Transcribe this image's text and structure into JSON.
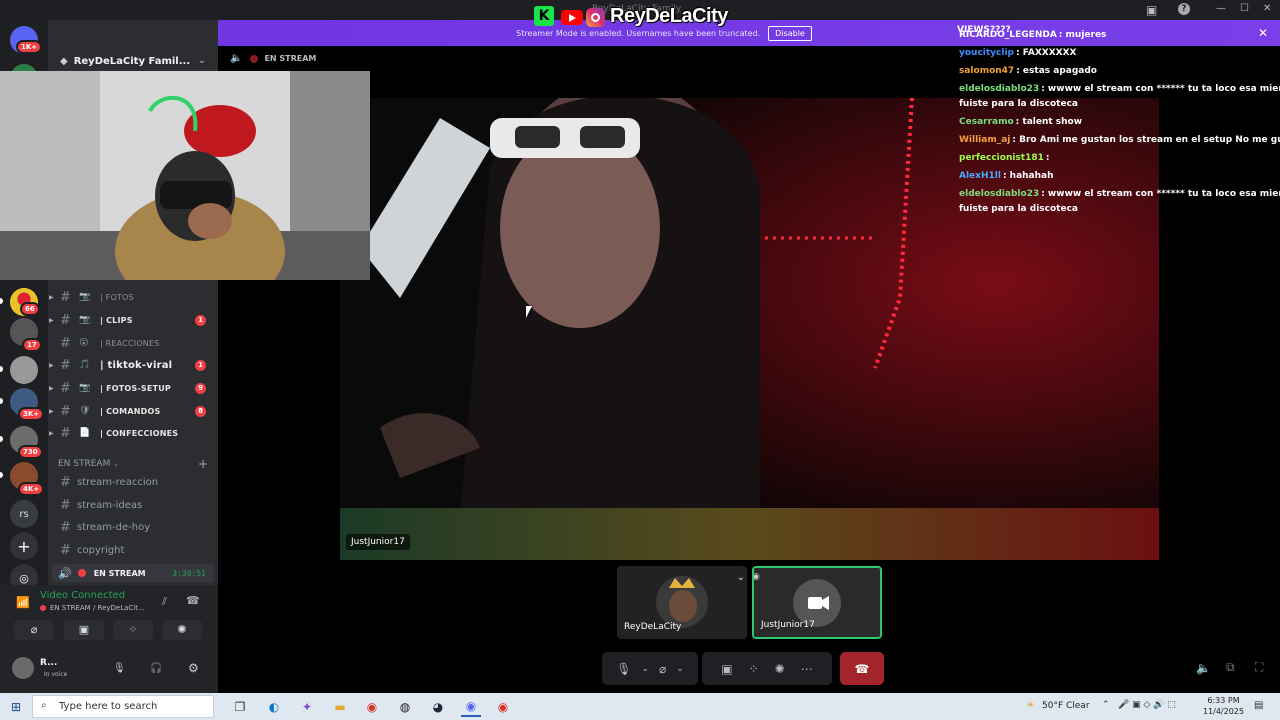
{
  "brand": {
    "header_text": "ReyDeLaCity",
    "header_faint": "ReyDeLaCity Family"
  },
  "streamer_bar": {
    "message": "Streamer Mode is enabled. Usernames have been truncated.",
    "disable_label": "Disable",
    "color": "#7a3fe8"
  },
  "server": {
    "name": "ReyDeLaCity Famil...",
    "voice_label": "EN STREAM"
  },
  "rail_badges": [
    "1K+",
    "66",
    "17",
    "3K+",
    "730",
    "4K+"
  ],
  "rail_text_server": "rs",
  "channels": [
    {
      "emoji": "📷",
      "label": "| FOTOS",
      "count": ""
    },
    {
      "emoji": "📷",
      "label": "| CLIPS",
      "count": "1"
    },
    {
      "emoji": "😮",
      "label": "| REACCIONES",
      "count": ""
    },
    {
      "emoji": "🎵",
      "label": "| tiktok-viral",
      "count": "1"
    },
    {
      "emoji": "📷",
      "label": "| FOTOS-SETUP",
      "count": "9"
    },
    {
      "emoji": "🛡",
      "label": "| COMANDOS",
      "count": "8"
    },
    {
      "emoji": "📄",
      "label": "| CONFECCIONES",
      "count": ""
    }
  ],
  "category": {
    "label": "EN STREAM"
  },
  "text_channels": [
    "stream-reaccion",
    "stream-ideas",
    "stream-de-hoy",
    "copyright"
  ],
  "voice_channel": {
    "label": "EN STREAM",
    "duration": "3:30:51"
  },
  "voice_panel": {
    "status": "Video Connected",
    "sub": "EN STREAM / ReyDeLaCit...",
    "user": "R...",
    "user_status": "In voice"
  },
  "stream": {
    "name_tag": "JustJunior17"
  },
  "tiles": [
    {
      "name": "ReyDeLaCity"
    },
    {
      "name": "JustJunior17"
    }
  ],
  "chat": {
    "title": "VIEWS????",
    "lines": [
      {
        "user": "RICARDO_LEGENDA",
        "color": "#ffffff",
        "msg": ": mujeres"
      },
      {
        "user": "youcityclip",
        "color": "#3b8cff",
        "msg": ": FAXXXXXX"
      },
      {
        "user": "salomon47",
        "color": "#f4a13a",
        "msg": ": estas apagado"
      },
      {
        "user": "eldelosdiablo23",
        "color": "#7be07b",
        "msg": ": wwww el stream con ****** tu ta loco esa mierda de stre"
      },
      {
        "user": "",
        "color": "#ffffff",
        "msg": "fuiste para la discoteca"
      },
      {
        "user": "Cesarramo",
        "color": "#7be07b",
        "msg": ": talent show"
      },
      {
        "user": "William_aj",
        "color": "#f4a13a",
        "msg": ": Bro Ami me gustan los stream en el setup No me gusta casi"
      },
      {
        "user": "perfeccionist181",
        "color": "#9bff4a",
        "msg": ":"
      },
      {
        "user": "AlexH1ll",
        "color": "#4aa8ff",
        "msg": ": hahahah"
      },
      {
        "user": "eldelosdiablo23",
        "color": "#7be07b",
        "msg": ": wwww el stream con ****** tu ta loco esa mierda de stre"
      },
      {
        "user": "",
        "color": "#ffffff",
        "msg": "fuiste para la discoteca"
      }
    ]
  },
  "taskbar": {
    "search_placeholder": "Type here to search",
    "weather": "50°F  Clear",
    "time": "6:33 PM",
    "date": "11/4/2025"
  }
}
